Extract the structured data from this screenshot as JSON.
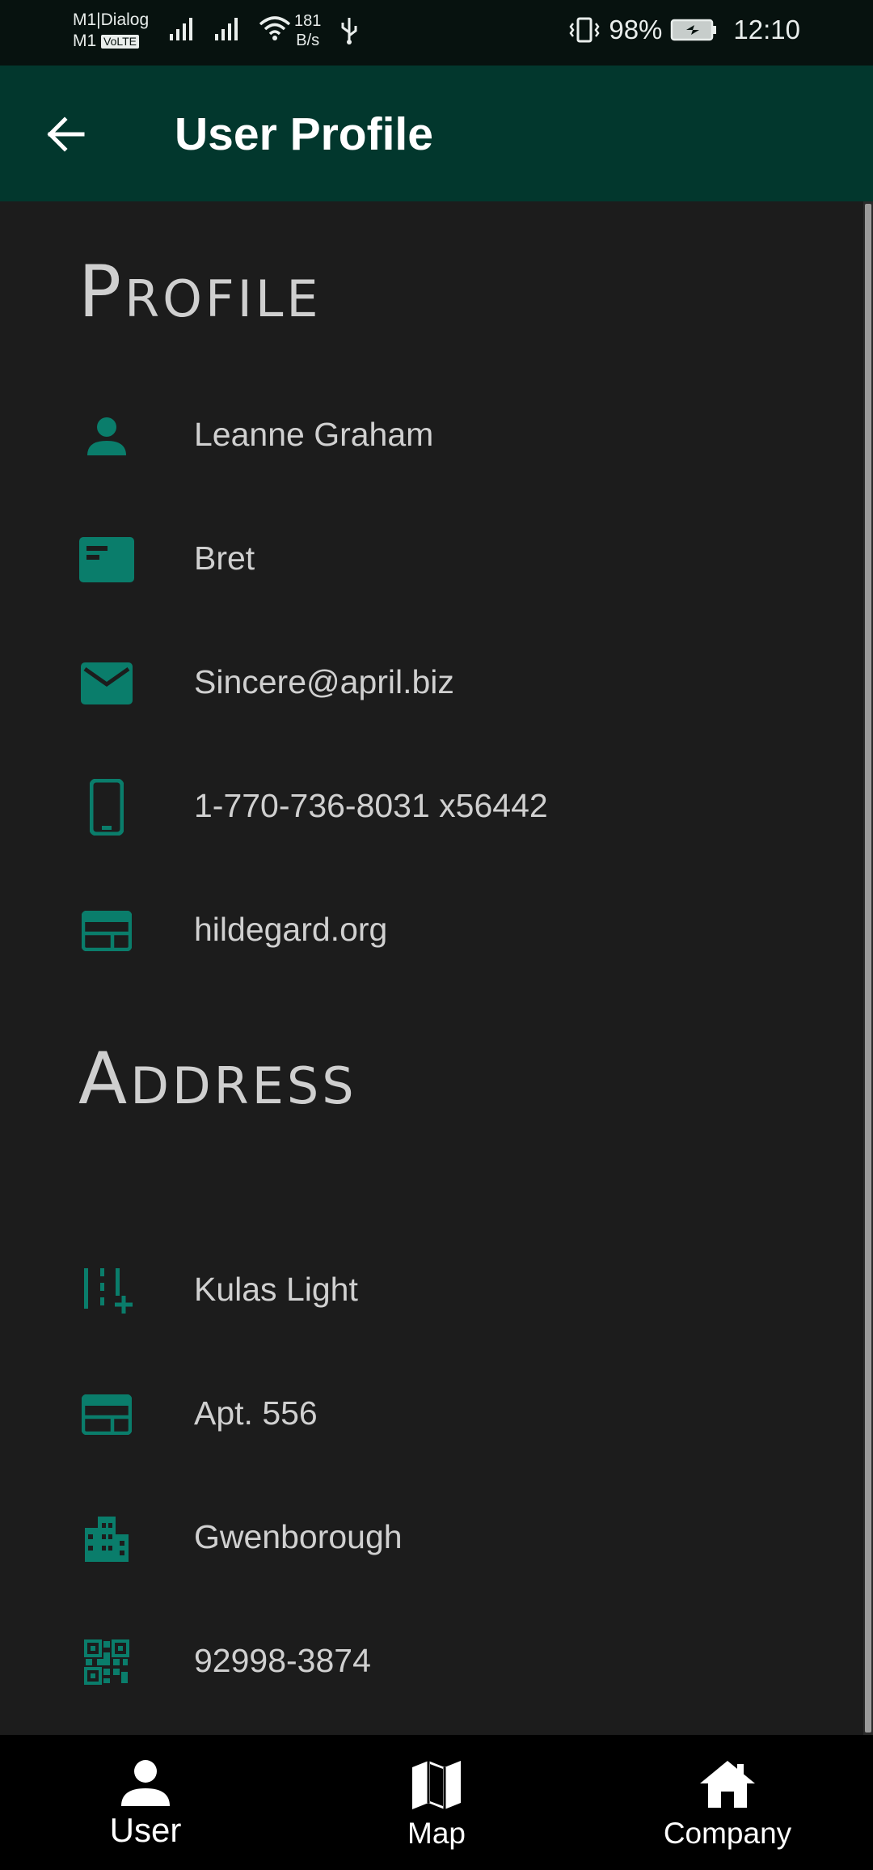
{
  "status_bar": {
    "carrier_1": "M1|Dialog",
    "carrier_2": "M1",
    "volte": "VoLTE",
    "speed_value": "181",
    "speed_unit": "B/s",
    "battery": "98%",
    "time": "12:10"
  },
  "app_bar": {
    "title": "User Profile",
    "back_icon": "arrow-back-icon"
  },
  "colors": {
    "accent": "#0a7d6b",
    "app_bar": "#02372d",
    "background": "#1c1c1c",
    "text": "#d0d0d0"
  },
  "profile": {
    "title": "Profile",
    "items": [
      {
        "icon": "person-icon",
        "value": "Leanne Graham"
      },
      {
        "icon": "id-card-icon",
        "value": "Bret"
      },
      {
        "icon": "email-icon",
        "value": "Sincere@april.biz"
      },
      {
        "icon": "phone-icon",
        "value": "1-770-736-8031 x56442"
      },
      {
        "icon": "web-icon",
        "value": "hildegard.org"
      }
    ]
  },
  "address": {
    "title": "Address",
    "items": [
      {
        "icon": "street-icon",
        "value": "Kulas Light"
      },
      {
        "icon": "suite-icon",
        "value": "Apt. 556"
      },
      {
        "icon": "city-icon",
        "value": "Gwenborough"
      },
      {
        "icon": "qr-code-icon",
        "value": "92998-3874"
      }
    ]
  },
  "bottom_nav": {
    "items": [
      {
        "icon": "user-icon",
        "label": "User"
      },
      {
        "icon": "map-icon",
        "label": "Map"
      },
      {
        "icon": "company-icon",
        "label": "Company"
      }
    ]
  }
}
